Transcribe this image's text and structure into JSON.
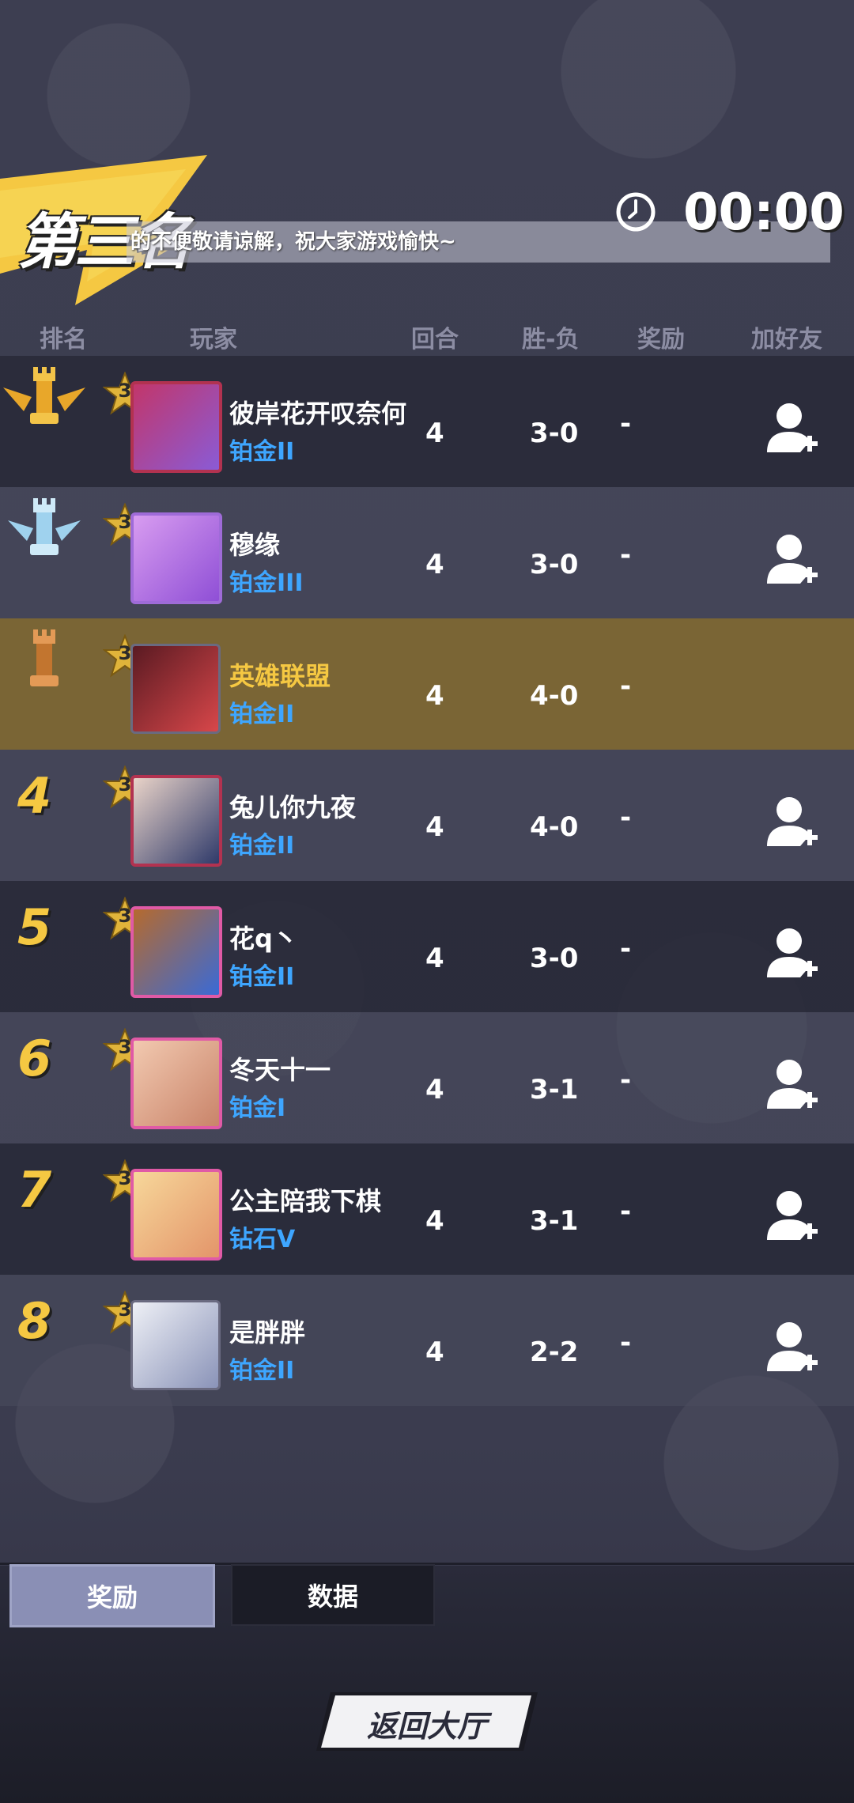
{
  "header": {
    "placement": "第三名",
    "marquee": "的不便敬请谅解，祝大家游戏愉快~",
    "timer": "00:00"
  },
  "columns": {
    "rank": "排名",
    "player": "玩家",
    "rounds": "回合",
    "win_loss": "胜-负",
    "reward": "奖励",
    "add_friend": "加好友"
  },
  "players": [
    {
      "rank": "1",
      "name": "彼岸花开叹奈何",
      "tier": "铂金II",
      "level": "3",
      "rounds": "4",
      "win_loss": "3-0",
      "reward": "-",
      "add_friend": true
    },
    {
      "rank": "2",
      "name": "穆缘",
      "tier": "铂金III",
      "level": "3",
      "rounds": "4",
      "win_loss": "3-0",
      "reward": "-",
      "add_friend": true
    },
    {
      "rank": "3",
      "name": "英雄联盟",
      "tier": "铂金II",
      "level": "3",
      "rounds": "4",
      "win_loss": "4-0",
      "reward": "-",
      "add_friend": false
    },
    {
      "rank": "4",
      "name": "兔儿你九夜",
      "tier": "铂金II",
      "level": "3",
      "rounds": "4",
      "win_loss": "4-0",
      "reward": "-",
      "add_friend": true
    },
    {
      "rank": "5",
      "name": "花q丶",
      "tier": "铂金II",
      "level": "3",
      "rounds": "4",
      "win_loss": "3-0",
      "reward": "-",
      "add_friend": true
    },
    {
      "rank": "6",
      "name": "冬天十一",
      "tier": "铂金I",
      "level": "3",
      "rounds": "4",
      "win_loss": "3-1",
      "reward": "-",
      "add_friend": true
    },
    {
      "rank": "7",
      "name": "公主陪我下棋",
      "tier": "钻石V",
      "level": "3",
      "rounds": "4",
      "win_loss": "3-1",
      "reward": "-",
      "add_friend": true
    },
    {
      "rank": "8",
      "name": "是胖胖",
      "tier": "铂金II",
      "level": "3",
      "rounds": "4",
      "win_loss": "2-2",
      "reward": "-",
      "add_friend": true
    }
  ],
  "tabs": {
    "reward": "奖励",
    "data": "数据"
  },
  "back_button": "返回大厅",
  "colors": {
    "gold_rank": "#f5c842",
    "tier_blue": "#3ea6ff",
    "highlight_row": "#7a6535"
  }
}
